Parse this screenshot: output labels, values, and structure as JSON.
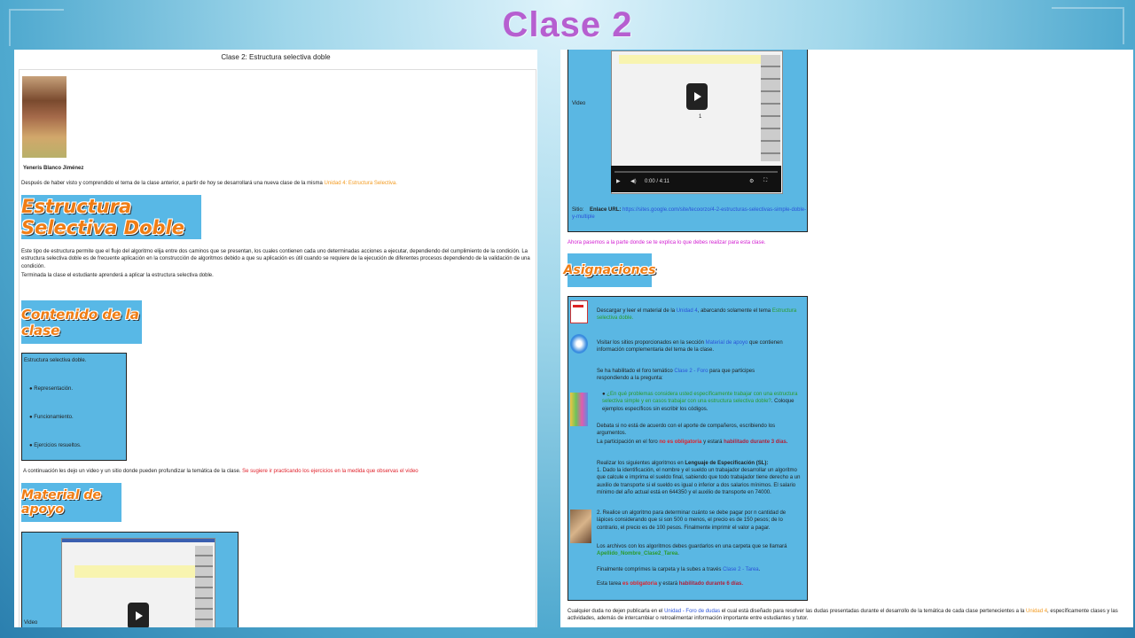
{
  "slide": {
    "title": "Clase 2"
  },
  "left": {
    "page_title": "Clase 2: Estructura selectiva doble",
    "author": "Yeneris Blanco Jiménez",
    "intro_prefix": "Después de haber visto y comprendido el tema de la clase anterior, a partir de hoy se desarrollará una nueva clase de la misma ",
    "intro_link": "Unidad 4: Estructura Selectiva.",
    "banner1": "Estructura Selectiva Doble",
    "description": "Este tipo de estructura permite que el flujo del algoritmo elija entre dos caminos que se presentan, los cuales contienen cada uno determinadas acciones a ejecutar, dependiendo del cumplimiento de la condición. La estructura selectiva doble es de frecuente aplicación en la construcción de algoritmos debido a que su aplicación es útil cuando se requiere de la ejecución de diferentes procesos dependiendo de la validación de una condición.",
    "closing": "Terminada la clase el estudiante aprenderá a aplicar la estructura selectiva doble.",
    "banner2": "Contenido de la clase",
    "content_box": {
      "title": "Estructura selectiva doble.",
      "items": [
        "Representación.",
        "Funcionamiento.",
        "Ejercicios resueltos."
      ]
    },
    "video_intro": "A continuación les dejo un video y un sitio donde pueden profundizar la temática de la clase.",
    "video_hint": "Se sugiere ir practicando los ejercicios en la medida que observas el video",
    "banner3": "Material de apoyo",
    "video_label": "Video"
  },
  "right": {
    "video_label": "Video",
    "video_time": "0:00 / 4:11",
    "video_counter": "1",
    "site_label": "Sitio:",
    "site_link_label": "Enlace URL:",
    "site_url": "https://sites.google.com/site/tecoorzo/4-2-estructuras-selectivas-simple-doble-y-multiple",
    "transition": "Ahora pasemos a la parte donde se te explica lo que debes realizar para esta clase.",
    "banner": "Asignaciones",
    "task1_prefix": "Descargar y leer el material de la ",
    "task1_link1": "Unidad 4",
    "task1_mid": ", abarcando solamente el tema ",
    "task1_link2": "Estructura selectiva doble.",
    "task2_prefix": "Visitar los sitios proporcionados en la sección ",
    "task2_link": "Material de apoyo",
    "task2_suffix": " que contienen información complementaria del tema de la clase.",
    "forum_prefix": "Se ha habilitado el foro temático  ",
    "forum_link": "Clase 2 - Foro",
    "forum_suffix": " para que participes respondiendo a la pregunta:",
    "question_green": "¿En qué problemas considera usted específicamente trabajar con una estructura selectiva simple y en casos trabajar con una estructura selectiva doble?",
    "question_tail": ". Coloque ejemplos específicos sin escribir los códigos.",
    "debate": "Debata si no está de acuerdo con el aporte de compañeros, escribiendo los argumentos.",
    "participation_prefix": "La participación en el foro ",
    "participation_bold1": "no es obligatoria",
    "participation_mid": " y estará ",
    "participation_bold2": "habilitado durante 3 días.",
    "algo_prefix": "Realizar los siguientes algoritmos en ",
    "algo_bold": "Lenguaje de Especificación (SL):",
    "algo1": "1. Dado la identificación, el nombre y el sueldo un trabajador desarrollar un algoritmo que calcule e imprima el sueldo final, sabiendo que todo trabajador tiene derecho a un auxilio de transporte si el sueldo es igual o inferior a dos salarios mínimos. El salario mínimo del año actual está en 644350 y el auxilio de transporte en 74000.",
    "algo2": "2. Realice un algoritmo para determinar cuánto se debe pagar por n cantidad de lápices considerando que si son 500 o menos, el precio es de 150 pesos; de lo contrario, el precio es de 100 pesos. Finalmente imprimir el valor a pagar.",
    "files_prefix": "Los archivos con los algoritmos debes guardarlos en una carpeta que se llamará ",
    "files_name": "Apellido_Nombre_Clase2_Tarea",
    "compress_prefix": "Finalmente comprimes la carpeta y la subes a través ",
    "compress_link": "Clase 2 - Tarea",
    "task_prefix": "Esta tarea ",
    "task_bold1": "es obligatoria",
    "task_mid": " y estará ",
    "task_bold2": "habilitado durante 6 días.",
    "footer_prefix": "Cualquier duda no dejen publicarla en el ",
    "footer_link1": "Unidad - Foro de dudas",
    "footer_mid": " el cual está diseñado para resolver las dudas presentadas durante el desarrollo de la temática de cada clase pertenecientes a la ",
    "footer_link2": "Unidad 4",
    "footer_suffix": ", específicamente clases y las actividades, además de intercambiar o retroalimentar información importante entre estudiantes y tutor."
  },
  "colors": {
    "title": "#b65fd0",
    "banner_bg": "#58b8e6",
    "banner_text": "#f07d14",
    "box_bg": "#5ab7e3"
  }
}
